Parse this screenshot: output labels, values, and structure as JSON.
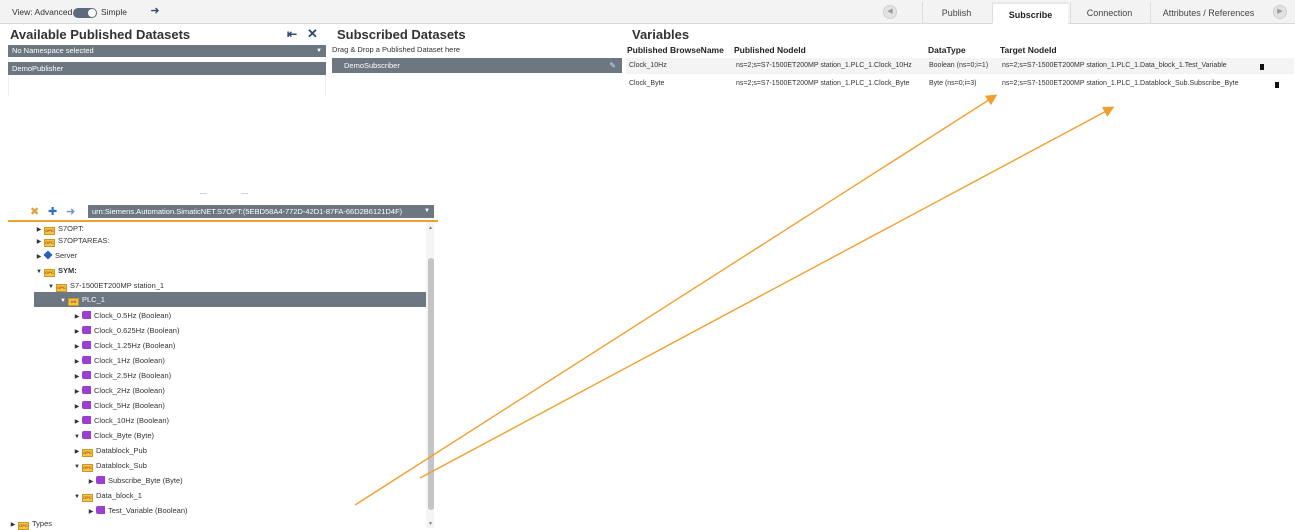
{
  "toolbar": {
    "view_label": "View: Advanced",
    "simple_label": "Simple",
    "tabs": [
      "Publish",
      "Subscribe",
      "Connection",
      "Attributes / References"
    ],
    "active_tab": "Subscribe"
  },
  "available": {
    "title": "Available Published Datasets",
    "namespace_select": "No Namespace selected",
    "items": [
      "DemoPublisher"
    ]
  },
  "subscribed": {
    "title": "Subscribed Datasets",
    "hint": "Drag & Drop a Published Dataset here",
    "items": [
      "DemoSubscriber"
    ]
  },
  "variables": {
    "title": "Variables",
    "columns": [
      "Published BrowseName",
      "Published NodeId",
      "DataType",
      "Target NodeId"
    ],
    "rows": [
      {
        "browse_name": "Clock_10Hz",
        "node_id": "ns=2;s=S7-1500ET200MP station_1.PLC_1.Clock_10Hz",
        "data_type": "Boolean (ns=0;i=1)",
        "target": "ns=2;s=S7-1500ET200MP station_1.PLC_1.Data_block_1.Test_Variable"
      },
      {
        "browse_name": "Clock_Byte",
        "node_id": "ns=2;s=S7-1500ET200MP station_1.PLC_1.Clock_Byte",
        "data_type": "Byte (ns=0;i=3)",
        "target": "ns=2;s=S7-1500ET200MP station_1.PLC_1.Datablock_Sub.Subscribe_Byte"
      }
    ]
  },
  "browser": {
    "endpoint": "urn:Siemens.Automation.SimaticNET.S7OPT:(5EBD58A4-772D-42D1-87FA-66D2B6121D4F)",
    "folder_badge": "OPC",
    "plc_badge": "DB",
    "tree": [
      {
        "label": "S7OPT:",
        "icon": "folder"
      },
      {
        "label": "S7OPTAREAS:",
        "icon": "folder"
      },
      {
        "label": "Server",
        "icon": "cube"
      },
      {
        "label": "SYM:",
        "icon": "folder"
      },
      {
        "label": "S7-1500ET200MP station_1",
        "icon": "folder"
      },
      {
        "label": "PLC_1",
        "icon": "folder"
      },
      {
        "label": "Clock_0.5Hz (Boolean)",
        "icon": "variable"
      },
      {
        "label": "Clock_0.625Hz (Boolean)",
        "icon": "variable"
      },
      {
        "label": "Clock_1.25Hz (Boolean)",
        "icon": "variable"
      },
      {
        "label": "Clock_1Hz (Boolean)",
        "icon": "variable"
      },
      {
        "label": "Clock_2.5Hz (Boolean)",
        "icon": "variable"
      },
      {
        "label": "Clock_2Hz (Boolean)",
        "icon": "variable"
      },
      {
        "label": "Clock_5Hz (Boolean)",
        "icon": "variable"
      },
      {
        "label": "Clock_10Hz (Boolean)",
        "icon": "variable"
      },
      {
        "label": "Clock_Byte (Byte)",
        "icon": "variable"
      },
      {
        "label": "Datablock_Pub",
        "icon": "folder"
      },
      {
        "label": "Datablock_Sub",
        "icon": "folder"
      },
      {
        "label": "Subscribe_Byte (Byte)",
        "icon": "variable"
      },
      {
        "label": "Data_block_1",
        "icon": "folder"
      },
      {
        "label": "Test_Variable (Boolean)",
        "icon": "variable"
      },
      {
        "label": "Types",
        "icon": "folder"
      }
    ]
  },
  "colors": {
    "accent": "#f0a030",
    "selected_bg": "#6c7782",
    "arrow": "#f0a030"
  }
}
